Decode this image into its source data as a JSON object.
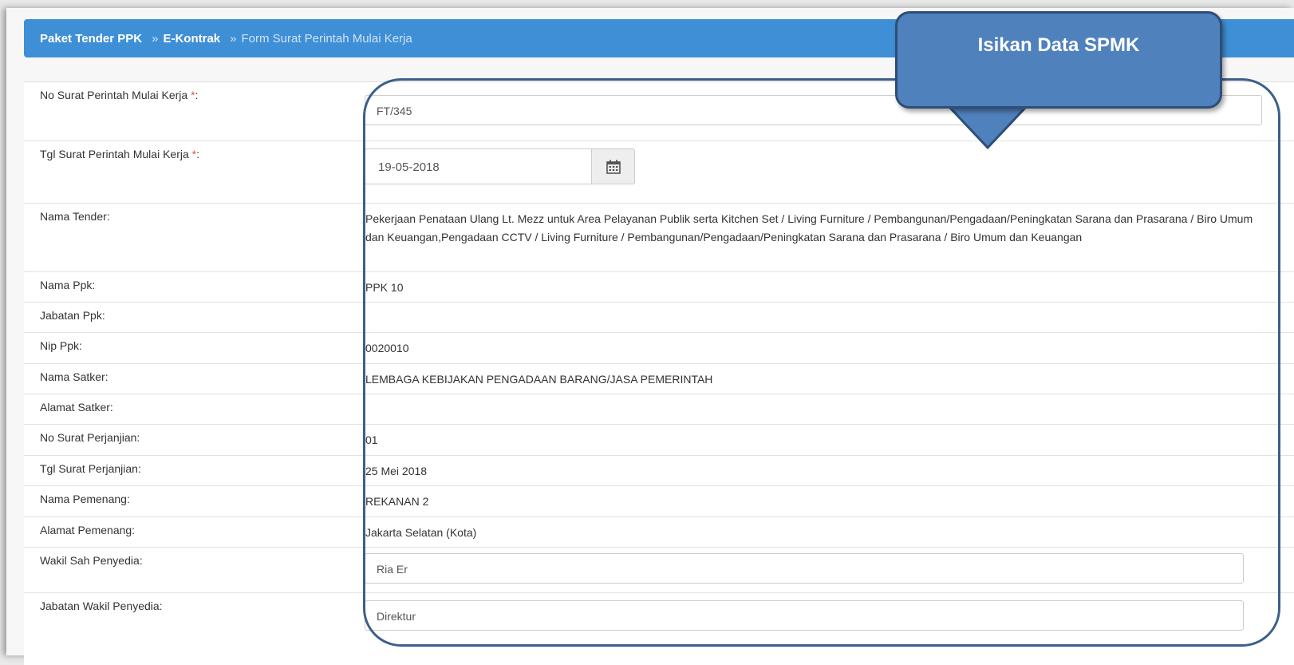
{
  "breadcrumb": {
    "items": [
      "Paket Tender PPK",
      "E-Kontrak",
      "Form Surat Perintah Mulai Kerja"
    ],
    "separator": "»"
  },
  "form": {
    "required_mark": "*",
    "no_spmk": {
      "label": "No Surat Perintah Mulai Kerja",
      "value": "FT/345"
    },
    "tgl_spmk": {
      "label": "Tgl Surat Perintah Mulai Kerja",
      "value": "19-05-2018",
      "icon": "calendar-icon"
    },
    "nama_tender": {
      "label": "Nama Tender:",
      "value": "Pekerjaan Penataan Ulang Lt. Mezz untuk Area Pelayanan Publik serta Kitchen Set / Living Furniture / Pembangunan/Pengadaan/Peningkatan Sarana dan Prasarana / Biro Umum dan Keuangan,Pengadaan CCTV / Living Furniture / Pembangunan/Pengadaan/Peningkatan Sarana dan Prasarana / Biro Umum dan Keuangan"
    },
    "nama_ppk": {
      "label": "Nama Ppk:",
      "value": "PPK 10"
    },
    "jabatan_ppk": {
      "label": "Jabatan Ppk:",
      "value": ""
    },
    "nip_ppk": {
      "label": "Nip Ppk:",
      "value": "0020010"
    },
    "nama_satker": {
      "label": "Nama Satker:",
      "value": "LEMBAGA KEBIJAKAN PENGADAAN BARANG/JASA PEMERINTAH"
    },
    "alamat_satker": {
      "label": "Alamat Satker:",
      "value": ""
    },
    "no_perjanjian": {
      "label": "No Surat Perjanjian:",
      "value": "01"
    },
    "tgl_perjanjian": {
      "label": "Tgl Surat Perjanjian:",
      "value": "25 Mei 2018"
    },
    "nama_pemenang": {
      "label": "Nama Pemenang:",
      "value": "REKANAN 2"
    },
    "alamat_pemenang": {
      "label": "Alamat Pemenang:",
      "value": "Jakarta Selatan (Kota)"
    },
    "wakil_sah": {
      "label": "Wakil Sah Penyedia:",
      "value": "Ria Er"
    },
    "jabatan_wakil": {
      "label": "Jabatan Wakil Penyedia:",
      "value": "Direktur"
    }
  },
  "callout": {
    "text": "Isikan Data SPMK"
  },
  "colors": {
    "header_blue": "#3f8fd6",
    "callout_fill": "#4f81bd",
    "callout_border": "#2e4e76",
    "required_red": "#d9534f"
  }
}
